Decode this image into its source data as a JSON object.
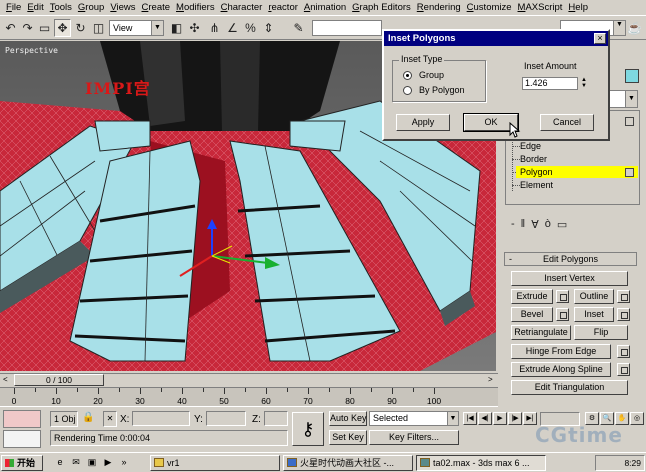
{
  "menu": [
    "File",
    "Edit",
    "Tools",
    "Group",
    "Views",
    "Create",
    "Modifiers",
    "Character",
    "reactor",
    "Animation",
    "Graph Editors",
    "Rendering",
    "Customize",
    "MAXScript",
    "Help"
  ],
  "toolbar": {
    "view_select": "View",
    "icons": [
      "undo-icon",
      "redo-icon",
      "link-icon",
      "unlink-icon",
      "bind-icon",
      "select-icon",
      "select-by-name-icon",
      "rect-region-icon",
      "window-crossing-icon",
      "move-icon",
      "rotate-icon",
      "scale-icon",
      "pivot-icon",
      "manipulate-icon",
      "snap-icon",
      "angle-snap-icon",
      "percent-snap-icon",
      "spinner-snap-icon",
      "named-sets-icon",
      "mirror-icon",
      "align-icon",
      "teapot-icon"
    ]
  },
  "viewport": {
    "label": "Perspective",
    "logo_text": "IMPI宫"
  },
  "dialog": {
    "title": "Inset Polygons",
    "close": "×",
    "inset_type_label": "Inset Type",
    "options": [
      {
        "label": "Group",
        "checked": true
      },
      {
        "label": "By Polygon",
        "checked": false
      }
    ],
    "inset_amount_label": "Inset Amount",
    "inset_amount_value": "1.426",
    "apply": "Apply",
    "ok": "OK",
    "cancel": "Cancel"
  },
  "stack": {
    "items": [
      {
        "label": "Edge",
        "selected": false
      },
      {
        "label": "Border",
        "selected": false
      },
      {
        "label": "Polygon",
        "selected": true
      },
      {
        "label": "Element",
        "selected": false
      }
    ],
    "buttons": [
      "-",
      "‖",
      "∀",
      "ò",
      "▭"
    ]
  },
  "edit_polygons": {
    "title": "Edit Polygons",
    "pm": "-",
    "insert_vertex": "Insert Vertex",
    "extrude": "Extrude",
    "outline": "Outline",
    "bevel": "Bevel",
    "inset": "Inset",
    "retriangulate": "Retriangulate",
    "flip": "Flip",
    "hinge_from_edge": "Hinge From Edge",
    "extrude_along_spline": "Extrude Along Spline",
    "edit_triangulation": "Edit Triangulation"
  },
  "timeline": {
    "slider": "0 / 100",
    "left_arrow": "<",
    "right_arrow": ">"
  },
  "trackbar": {
    "labels": [
      "0",
      "10",
      "20",
      "30",
      "40",
      "50",
      "60",
      "70",
      "80",
      "90",
      "100"
    ]
  },
  "status": {
    "objects": "1 Obj",
    "x_label": "X:",
    "y_label": "Y:",
    "z_label": "Z:",
    "rendering_time": "Rendering Time  0:00:04",
    "autokey": "Auto Key",
    "setkey": "Set Key",
    "selected": "Selected",
    "key_filters": "Key Filters...",
    "watermark": "CGtime"
  },
  "taskbar": {
    "start": "开始",
    "tasks": [
      "vr1",
      "火星时代动画大社区 -...",
      "ta02.max - 3ds max 6 ..."
    ],
    "clock": "8:29"
  },
  "colors": {
    "dialog_title": "#000080",
    "selected_highlight": "#ffff00",
    "mesh_cyan": "#a8e0e8",
    "mesh_red": "#c02030"
  }
}
